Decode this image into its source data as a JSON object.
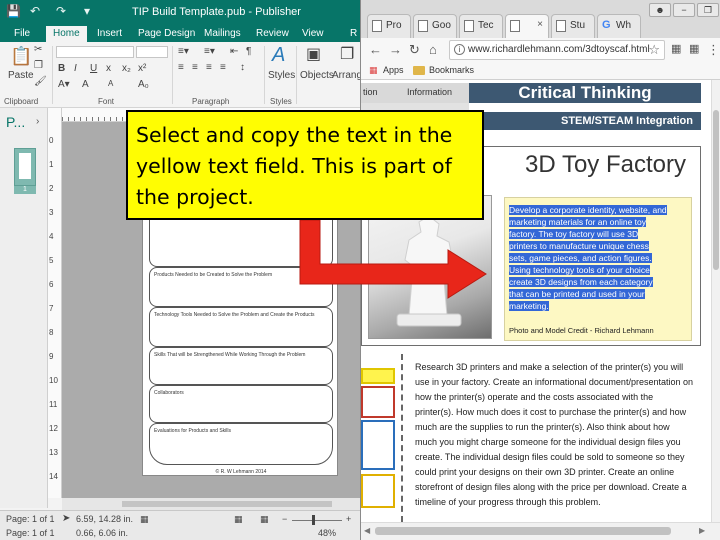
{
  "publisher": {
    "title": "TIP Build Template.pub - Publisher",
    "tabs": [
      "File",
      "Home",
      "Insert",
      "Page Design",
      "Mailings",
      "Review",
      "View",
      "R"
    ],
    "active_tab": "Home",
    "ribbon": {
      "paste_label": "Paste",
      "groups": [
        "Clipboard",
        "Font",
        "Paragraph",
        "Styles"
      ],
      "styles_label": "Styles",
      "objects_label": "Objects",
      "arrange_label": "Arrang",
      "font_grow": "A",
      "font_shrink": "A"
    },
    "pages_pane_label": "P...",
    "page_thumb_number": "1",
    "vruler_numbers": [
      "0",
      "1",
      "2",
      "3",
      "4",
      "5",
      "6",
      "7",
      "8",
      "9",
      "10",
      "11",
      "12",
      "13",
      "14"
    ],
    "document": {
      "boxes": [
        "Products Needed to be Created to Solve the Problem",
        "Technology Tools Needed to Solve the Problem and Create the Products",
        "Skills That will be Strengthened While Working Through the Problem",
        "Collaborators",
        "Evaluations for Products and Skills"
      ],
      "copyright": "© R. W Lehmann 2014"
    },
    "status": {
      "page": "Page: 1 of 1",
      "position": "6.59, 14.28 in.",
      "page2": "Page: 1 of 1",
      "size": "0.66, 6.06 in.",
      "zoom": "48%"
    }
  },
  "chrome": {
    "tabs": [
      {
        "label": "Pro",
        "active": false
      },
      {
        "label": "Goo",
        "active": false
      },
      {
        "label": "Tec",
        "active": false
      },
      {
        "label": "",
        "active": true
      },
      {
        "label": "Stu",
        "active": false
      },
      {
        "label": "Wh",
        "active": false
      }
    ],
    "url": "www.richardlehmann.com/3dtoyscaf.html",
    "bookmarks": [
      "Apps",
      "Bookmarks"
    ]
  },
  "page": {
    "nav_items": [
      "tion",
      "Information"
    ],
    "header_title": "Critical Thinking",
    "subheader": "STEM/STEAM Integration",
    "toy_title": "3D Toy Factory",
    "selected_text_lines": [
      "Develop a corporate identity, website, and",
      "marketing materials for an online toy",
      "factory. The toy factory will use 3D",
      "printers to manufacture unique chess",
      "sets, game pieces, and action figures.",
      "Using technology tools of your choice",
      "create 3D designs from each category",
      "that can be printed and used in your",
      "marketing."
    ],
    "photo_credit": "Photo and Model Credit - Richard Lehmann",
    "research_text": "Research 3D printers and make a selection of the printer(s) you will use in your factory. Create an informational document/presentation on how the printer(s) operate and the costs associated with the printer(s). How much does it cost to purchase the printer(s) and how much are the supplies to run the printer(s). Also think about how much you might charge someone for the individual design files you create. The individual design files could be sold to someone so they could print your designs on their own 3D printer. Create an online storefront of design files along with the price per download. Create a timeline of your progress through this problem."
  },
  "callout": {
    "text": "Select and copy the text in the yellow text field. This is part of the project.",
    "color": "#fffd02",
    "arrow_color": "#e8261a"
  }
}
